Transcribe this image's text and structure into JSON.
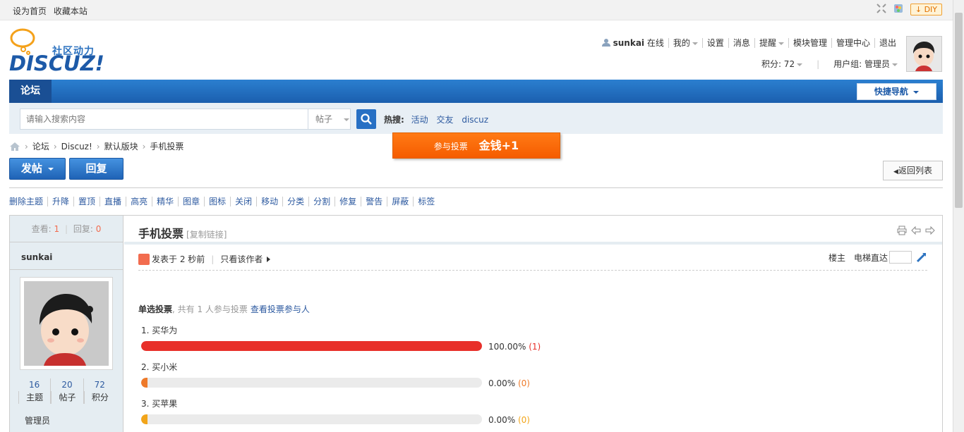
{
  "toptb": {
    "set_home": "设为首页",
    "bookmark": "收藏本站",
    "diy": "DIY"
  },
  "logo": {
    "slogan": "社区动力",
    "brand": "DISCUZ!"
  },
  "user_menu": {
    "username": "sunkai",
    "status": "在线",
    "items": [
      "我的",
      "设置",
      "消息",
      "提醒",
      "模块管理",
      "管理中心",
      "退出"
    ],
    "credits": "积分: 72",
    "usergroup": "用户组: 管理员"
  },
  "nav": {
    "forum_tab": "论坛",
    "quick_nav": "快捷导航"
  },
  "search": {
    "placeholder": "请输入搜索内容",
    "type": "帖子",
    "hot_label": "热搜:",
    "hot_items": [
      "活动",
      "交友",
      "discuz"
    ]
  },
  "breadcrumb": [
    "论坛",
    "Discuz!",
    "默认版块",
    "手机投票"
  ],
  "vote_popup": {
    "label": "参与投票",
    "reward": "金钱+1"
  },
  "actions": {
    "post": "发帖",
    "reply": "回复",
    "back": "返回列表"
  },
  "mod_links": [
    "删除主题",
    "升降",
    "置顶",
    "直播",
    "高亮",
    "精华",
    "图章",
    "图标",
    "关闭",
    "移动",
    "分类",
    "分割",
    "修复",
    "警告",
    "屏蔽",
    "标签"
  ],
  "sidebar": {
    "views_label": "查看:",
    "views": "1",
    "replies_label": "回复:",
    "replies": "0",
    "author": "sunkai",
    "stats": [
      {
        "value": "16",
        "label": "主题"
      },
      {
        "value": "20",
        "label": "帖子"
      },
      {
        "value": "72",
        "label": "积分"
      }
    ],
    "group": "管理员"
  },
  "post": {
    "title": "手机投票",
    "copy_link": "[复制链接]",
    "posted": "发表于 2 秒前",
    "only_author": "只看该作者",
    "floor": "楼主",
    "jump_label": "电梯直达"
  },
  "poll": {
    "type_label": "单选投票",
    "summary": ", 共有 1 人参与投票",
    "view_voters": "查看投票参与人",
    "options": [
      {
        "label": "1.  买华为",
        "percent_text": "100.00%",
        "count_text": "(1)",
        "fraction": 1.0,
        "color": "#e8302a"
      },
      {
        "label": "2.  买小米",
        "percent_text": "0.00%",
        "count_text": "(0)",
        "fraction": 0.0,
        "color": "#ee7a2a"
      },
      {
        "label": "3.  买苹果",
        "percent_text": "0.00%",
        "count_text": "(0)",
        "fraction": 0.0,
        "color": "#f2a51a"
      }
    ]
  }
}
